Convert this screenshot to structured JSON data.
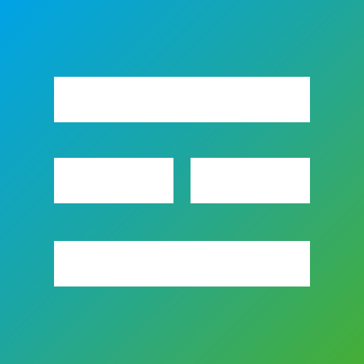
{
  "app_icon": {
    "icon": "grid-layout-icon",
    "colors": {
      "gradient_start": "#00a3e6",
      "gradient_end": "#45ae35",
      "bars": "#ffffff"
    }
  }
}
